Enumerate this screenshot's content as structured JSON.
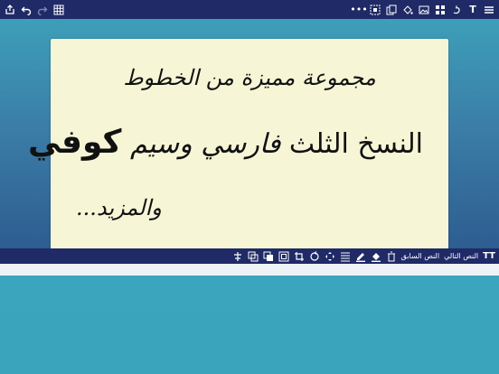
{
  "card": {
    "line1": "مجموعة مميزة من الخطوط",
    "line2_parts": [
      "النسخ",
      "الثلث",
      "فارسي",
      "وسيم",
      "كوفي"
    ],
    "line3": "والمزيد..."
  },
  "bottom_bar": {
    "layer_labels": [
      "النص السابق",
      "النص التالي"
    ]
  },
  "colors": {
    "toolbar": "#1f2a66",
    "card_bg": "#f6f6d7",
    "strip": "#eef2f7",
    "canvas_top": "#3d9fb9",
    "canvas_bottom": "#2e5d91"
  }
}
